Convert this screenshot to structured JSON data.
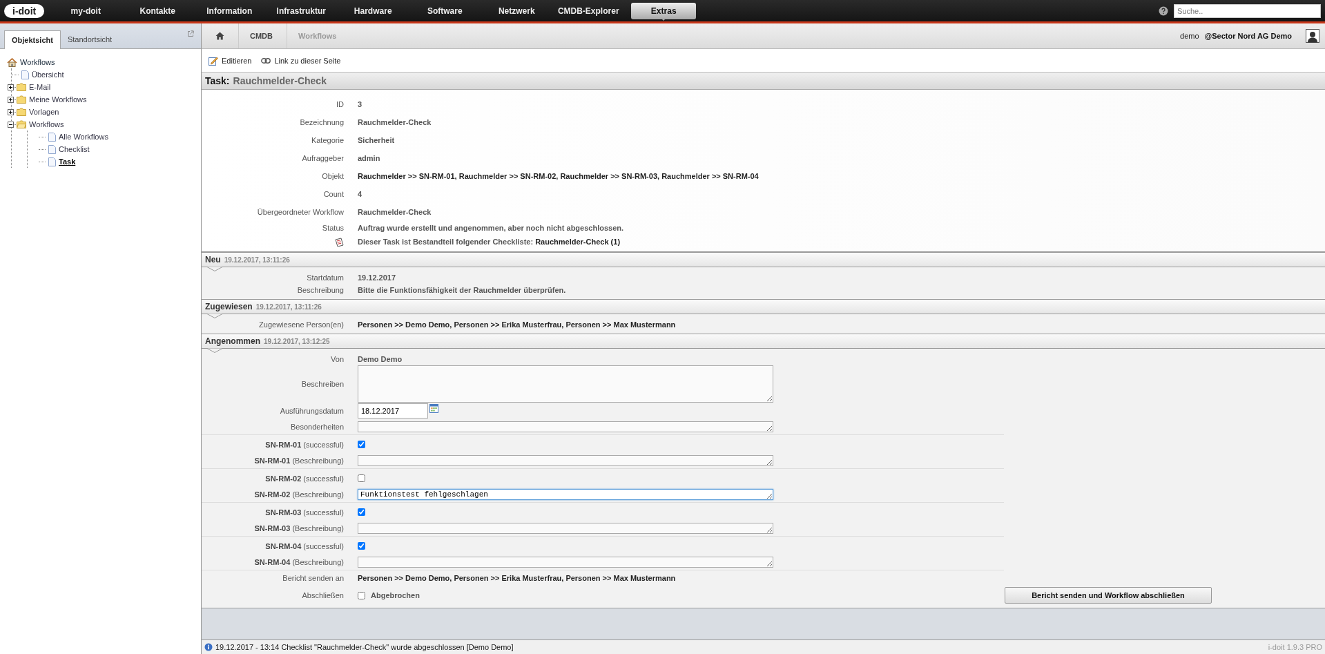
{
  "logo": {
    "text": "i-doit"
  },
  "nav": [
    {
      "label": "my-doit",
      "selected": false
    },
    {
      "label": "Kontakte",
      "selected": false
    },
    {
      "label": "Information",
      "selected": false
    },
    {
      "label": "Infrastruktur",
      "selected": false
    },
    {
      "label": "Hardware",
      "selected": false
    },
    {
      "label": "Software",
      "selected": false
    },
    {
      "label": "Netzwerk",
      "selected": false
    },
    {
      "label": "CMDB-Explorer",
      "selected": false
    },
    {
      "label": "Extras",
      "selected": true
    }
  ],
  "search": {
    "placeholder": "Suche.."
  },
  "sidebar": {
    "tabs": [
      {
        "label": "Objektsicht",
        "selected": true
      },
      {
        "label": "Standortsicht",
        "selected": false
      }
    ],
    "tree": {
      "label": "Workflows",
      "kind": "home",
      "selected": false,
      "children": [
        {
          "label": "Übersicht",
          "kind": "page",
          "selected": false
        },
        {
          "label": "E-Mail",
          "kind": "folder",
          "expanded": false,
          "selected": false
        },
        {
          "label": "Meine Workflows",
          "kind": "folder",
          "expanded": false,
          "selected": false
        },
        {
          "label": "Vorlagen",
          "kind": "folder",
          "expanded": false,
          "selected": false
        },
        {
          "label": "Workflows",
          "kind": "folder",
          "expanded": true,
          "selected": false,
          "children": [
            {
              "label": "Alle Workflows",
              "kind": "page",
              "selected": false
            },
            {
              "label": "Checklist",
              "kind": "page",
              "selected": false
            },
            {
              "label": "Task",
              "kind": "page",
              "selected": true
            }
          ]
        }
      ]
    }
  },
  "breadcrumb": [
    "CMDB",
    "Workflows"
  ],
  "user": {
    "name": "demo",
    "tenant": "@Sector Nord AG Demo"
  },
  "toolbar": [
    "Editieren",
    "Link zu dieser Seite"
  ],
  "task": {
    "prefix": "Task:",
    "title": "Rauchmelder-Check"
  },
  "details": [
    {
      "label": "ID",
      "value": "3",
      "strong": false
    },
    {
      "label": "Bezeichnung",
      "value": "Rauchmelder-Check",
      "strong": false
    },
    {
      "label": "Kategorie",
      "value": "Sicherheit",
      "strong": false
    },
    {
      "label": "Aufraggeber",
      "value": "admin",
      "strong": false
    },
    {
      "label": "Objekt",
      "value": "Rauchmelder >> SN-RM-01, Rauchmelder >> SN-RM-02, Rauchmelder >> SN-RM-03, Rauchmelder >> SN-RM-04",
      "strong": true
    },
    {
      "label": "Count",
      "value": "4",
      "strong": false
    },
    {
      "label": "Übergeordneter Workflow",
      "value": "Rauchmelder-Check",
      "strong": false
    }
  ],
  "status": {
    "label": "Status",
    "value": "Auftrag wurde erstellt und angenommen, aber noch nicht abgeschlossen."
  },
  "checklist_note": {
    "text": "Dieser Task ist Bestandteil folgender Checkliste:",
    "link": "Rauchmelder-Check (1)"
  },
  "sections": [
    {
      "title": "Neu",
      "timestamp": "19.12.2017, 13:11:26",
      "rows": [
        {
          "kind": "text",
          "label": "Startdatum",
          "value": "19.12.2017",
          "strong": false
        },
        {
          "kind": "text",
          "label": "Beschreibung",
          "value": "Bitte die Funktionsfähigkeit der Rauchmelder überprüfen.",
          "strong": false
        }
      ]
    },
    {
      "title": "Zugewiesen",
      "timestamp": "19.12.2017, 13:11:26",
      "rows": [
        {
          "kind": "text",
          "label": "Zugewiesene Person(en)",
          "value": "Personen >> Demo Demo, Personen >> Erika Musterfrau, Personen >> Max Mustermann",
          "strong": true
        }
      ]
    },
    {
      "title": "Angenommen",
      "timestamp": "19.12.2017, 13:12:25",
      "rows": [
        {
          "kind": "text",
          "label": "Von",
          "value": "Demo Demo",
          "strong": false
        },
        {
          "kind": "textarea",
          "label": "Beschreiben"
        },
        {
          "kind": "date",
          "label": "Ausführungsdatum",
          "value": "18.12.2017"
        },
        {
          "kind": "field",
          "label": "Besonderheiten",
          "focused": false
        },
        {
          "kind": "check",
          "label": "**SN-RM-01** (successful)",
          "checked": true
        },
        {
          "kind": "field",
          "label": "**SN-RM-01** (Beschreibung)",
          "focused": false
        },
        {
          "kind": "check",
          "label": "**SN-RM-02** (successful)",
          "checked": false
        },
        {
          "kind": "field",
          "label": "**SN-RM-02** (Beschreibung)",
          "value": "Funktionstest fehlgeschlagen",
          "focused": true
        },
        {
          "kind": "check",
          "label": "**SN-RM-03** (successful)",
          "checked": true
        },
        {
          "kind": "field",
          "label": "**SN-RM-03** (Beschreibung)",
          "focused": false
        },
        {
          "kind": "check",
          "label": "**SN-RM-04** (successful)",
          "checked": true
        },
        {
          "kind": "field",
          "label": "**SN-RM-04** (Beschreibung)",
          "focused": false
        },
        {
          "kind": "text",
          "label": "Bericht senden an",
          "value": "Personen >> Demo Demo, Personen >> Erika Musterfrau, Personen >> Max Mustermann",
          "strong": true
        }
      ]
    }
  ],
  "finish": {
    "label": "Abschließen",
    "option": "Abgebrochen",
    "checked": false,
    "button": "Bericht senden und Workflow abschließen"
  },
  "status_bar": {
    "message": "19.12.2017 - 13:14 Checklist \"Rauchmelder-Check\" wurde abgeschlossen [Demo Demo]",
    "version": "i-doit 1.9.3 PRO"
  }
}
